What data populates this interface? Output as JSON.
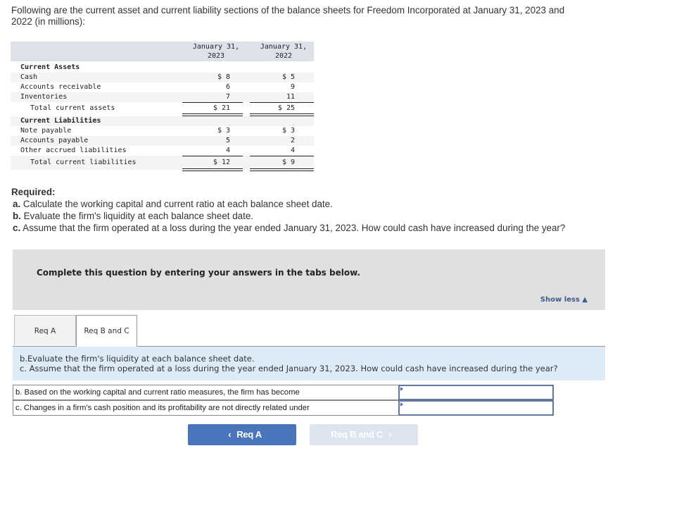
{
  "intro": {
    "line1": "Following are the current asset and current liability sections of the balance sheets for Freedom Incorporated at January 31, 2023 and",
    "line2": "2022 (in millions):"
  },
  "balance_sheet": {
    "columns": [
      {
        "line1": "January 31,",
        "line2": "2023"
      },
      {
        "line1": "January 31,",
        "line2": "2022"
      }
    ],
    "current_assets": {
      "heading": "Current Assets",
      "rows": [
        {
          "label": "Cash",
          "v2023": "$ 8",
          "v2022": "$ 5"
        },
        {
          "label": "Accounts receivable",
          "v2023": "6",
          "v2022": "9"
        },
        {
          "label": "Inventories",
          "v2023": "7",
          "v2022": "11"
        }
      ],
      "total": {
        "label": "Total current assets",
        "v2023": "$ 21",
        "v2022": "$ 25"
      }
    },
    "current_liabilities": {
      "heading": "Current Liabilities",
      "rows": [
        {
          "label": "Note payable",
          "v2023": "$ 3",
          "v2022": "$ 3"
        },
        {
          "label": "Accounts payable",
          "v2023": "5",
          "v2022": "2"
        },
        {
          "label": "Other accrued liabilities",
          "v2023": "4",
          "v2022": "4"
        }
      ],
      "total": {
        "label": "Total current liabilities",
        "v2023": "$ 12",
        "v2022": "$ 9"
      }
    }
  },
  "required": {
    "title": "Required:",
    "items": [
      {
        "letter": "a.",
        "text": " Calculate the working capital and current ratio at each balance sheet date."
      },
      {
        "letter": "b.",
        "text": " Evaluate the firm's liquidity at each balance sheet date."
      },
      {
        "letter": "c.",
        "text": " Assume that the firm operated at a loss during the year ended January 31, 2023. How could cash have increased during the year?"
      }
    ]
  },
  "panel": {
    "message": "Complete this question by entering your answers in the tabs below.",
    "show_less": "Show less ▲"
  },
  "tabs": [
    {
      "label": "Req A",
      "active": false
    },
    {
      "label": "Req B and C",
      "active": true
    }
  ],
  "question": {
    "line1": "b.Evaluate the firm's liquidity at each balance sheet date.",
    "line2": "c. Assume that the firm operated at a loss during the year ended January 31, 2023. How could cash have increased during the year?"
  },
  "answers": [
    {
      "prompt": "b. Based on the working capital and current ratio measures, the firm has become",
      "value": ""
    },
    {
      "prompt": "c. Changes in a firm's cash position and its profitability are not directly related under",
      "value": ""
    }
  ],
  "nav": {
    "prev_label": "Req A",
    "next_label": "Req B and C",
    "prev_icon": "‹",
    "next_icon": "›"
  }
}
